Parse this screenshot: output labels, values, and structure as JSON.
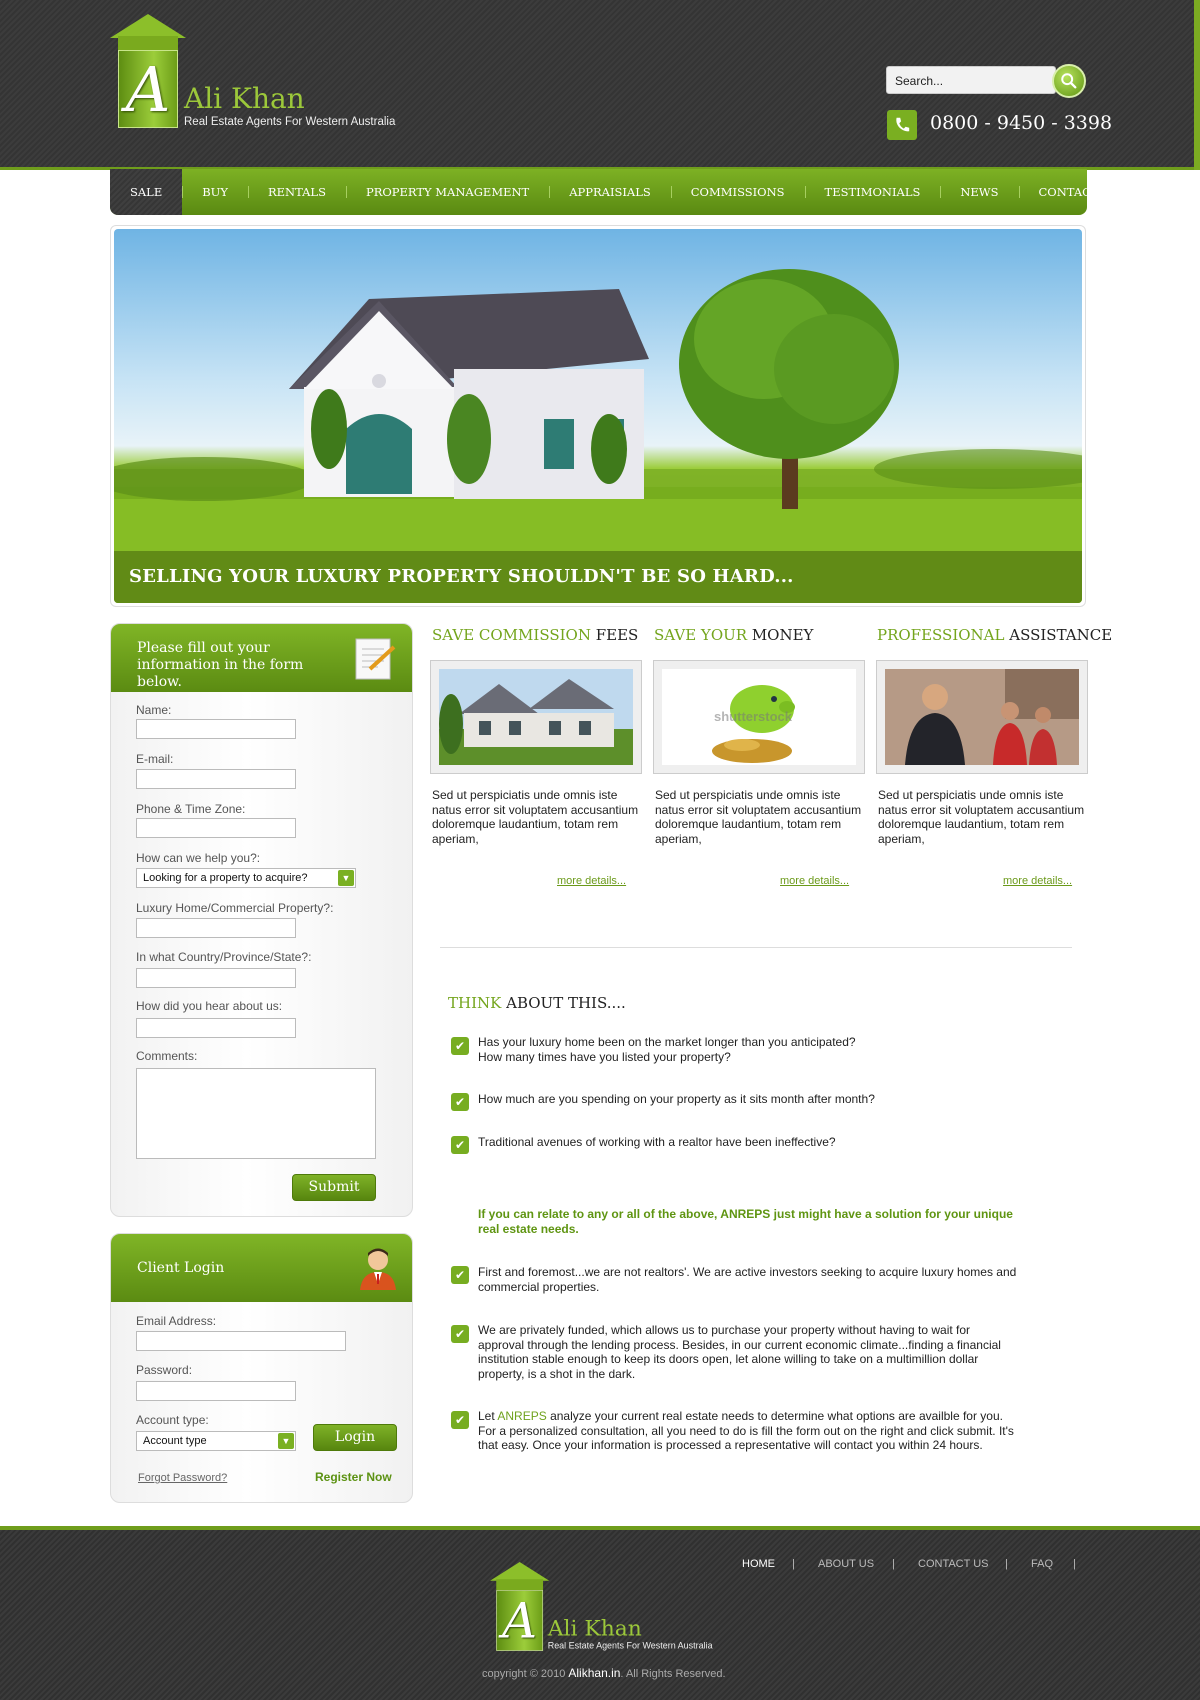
{
  "brand": {
    "initial": "A",
    "name": "Ali Khan",
    "tagline": "Real Estate Agents For Western Australia"
  },
  "header": {
    "search_placeholder": "Search...",
    "phone": "0800 - 9450 - 3398"
  },
  "nav": {
    "items": [
      "SALE",
      "BUY",
      "RENTALS",
      "PROPERTY MANAGEMENT",
      "APPRAISIALS",
      "COMMISSIONS",
      "TESTIMONIALS",
      "NEWS",
      "CONTACT"
    ],
    "active": "SALE"
  },
  "banner": {
    "caption": "SELLING YOUR LUXURY PROPERTY SHOULDN'T BE SO HARD..."
  },
  "info_form": {
    "title": "Please fill out your information in the form below.",
    "labels": {
      "name": "Name:",
      "email": "E-mail:",
      "phone": "Phone & Time Zone:",
      "help": "How can we help you?:",
      "property": "Luxury Home/Commercial Property?:",
      "country": "In what Country/Province/State?:",
      "hear": "How did you hear about us:",
      "comments": "Comments:"
    },
    "help_selected": "Looking for a property to acquire?",
    "submit_label": "Submit"
  },
  "login": {
    "title": "Client Login",
    "email_label": "Email Address:",
    "password_label": "Password:",
    "account_label": "Account type:",
    "account_selected": "Account type",
    "login_label": "Login",
    "forgot_label": "Forgot Password?",
    "register_label": "Register Now"
  },
  "features": [
    {
      "title_green": "SAVE COMMISSION",
      "title_dark": "FEES",
      "text": "Sed ut perspiciatis unde omnis iste natus error sit voluptatem accusantium doloremque laudantium, totam rem aperiam,",
      "more": "more details..."
    },
    {
      "title_green": "SAVE YOUR",
      "title_dark": "MONEY",
      "text": "Sed ut perspiciatis unde omnis iste natus error sit voluptatem accusantium doloremque laudantium, totam rem aperiam,",
      "more": "more details..."
    },
    {
      "title_green": "PROFESSIONAL",
      "title_dark": "ASSISTANCE",
      "text": "Sed ut perspiciatis unde omnis iste natus error sit voluptatem accusantium doloremque laudantium, totam rem aperiam,",
      "more": "more details..."
    }
  ],
  "watermark": "shutterstock",
  "think": {
    "title_green": "THINK",
    "title_dark": "ABOUT THIS....",
    "questions": [
      "Has your luxury home been on the market longer than you anticipated? How many times have you listed your property?",
      "How much are you spending on your property as it sits month after month?",
      "Traditional avenues of working with a realtor have been ineffective?"
    ],
    "highlight": "If you can relate to any or all of the above, ANREPS  just might have a solution for your unique real estate needs.",
    "points": [
      "First and foremost...we are not realtors'. We are active investors seeking to acquire luxury homes and commercial properties.",
      "We are privately funded, which allows us to purchase your property without having to wait for approval through the lending process. Besides, in our current economic climate...finding a financial institution stable enough to keep its doors open, let alone willing to take on a multimillion dollar property, is a shot in the dark."
    ],
    "last_point": {
      "prefix": "Let",
      "brand": "ANREPS",
      "rest": "analyze your current real estate needs to determine what options are availble for you. For a personalized consultation, all you need to do is fill the form out on the right and click submit. It's that easy. Once your information is processed a representative will contact you within 24 hours."
    }
  },
  "footer": {
    "nav": [
      "HOME",
      "ABOUT US",
      "CONTACT US",
      "FAQ"
    ],
    "separator": "|",
    "copyright_prefix": "copyright © 2010",
    "site": "Alikhan.in",
    "rights": "All Rights Reserved."
  },
  "colors": {
    "accent": "#74a51d",
    "dark": "#383838"
  }
}
